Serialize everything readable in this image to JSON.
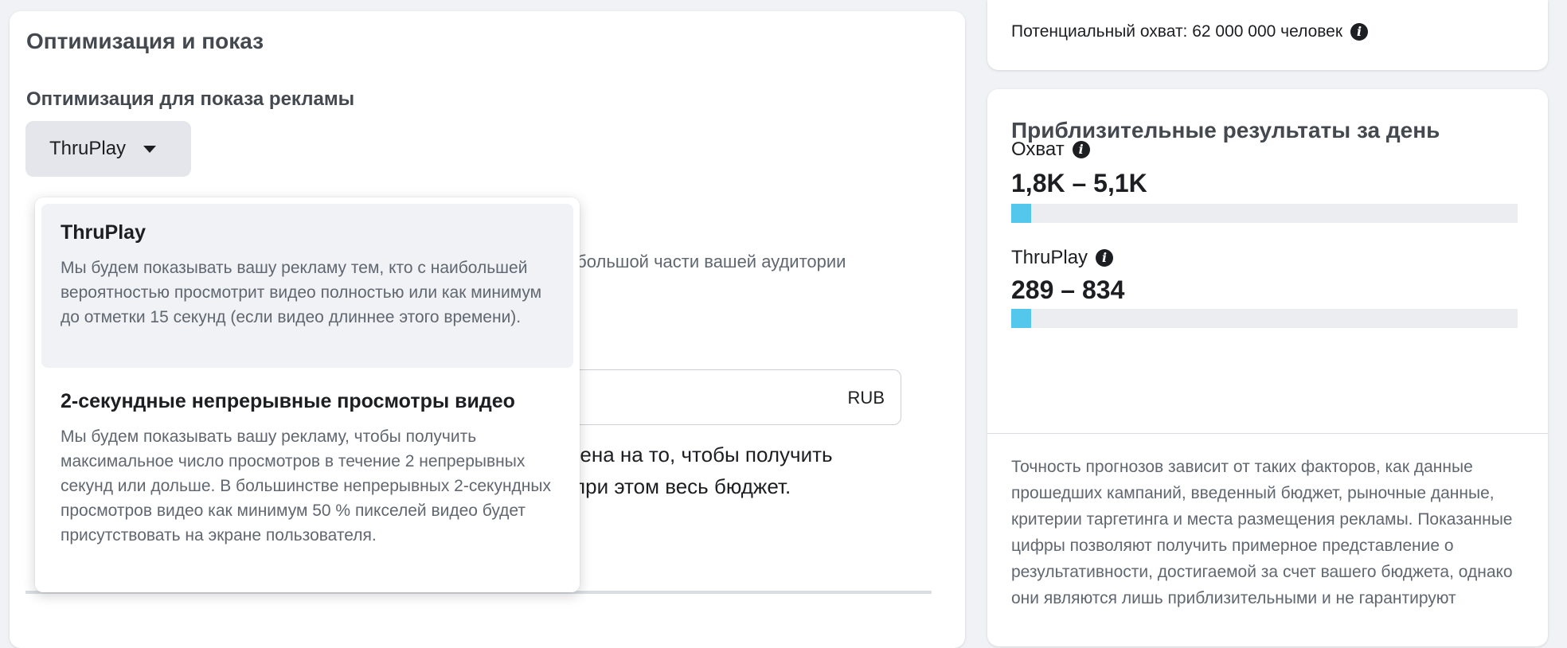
{
  "optimization": {
    "section_title": "Оптимизация и показ",
    "label": "Оптимизация для показа рекламы",
    "selected": "ThruPlay",
    "options": [
      {
        "title": "ThruPlay",
        "description": "Мы будем показывать вашу рекламу тем, кто с наибольшей вероятностью просмотрит видео полностью или как минимум до отметки 15 секунд (если видео длиннее этого времени)."
      },
      {
        "title": "2-секундные непрерывные просмотры видео",
        "description": "Мы будем показывать вашу рекламу, чтобы получить максимальное число просмотров в течение 2 непрерывных секунд или дольше. В большинстве непрерывных 2-секундных просмотров видео как минимум 50 % пикселей видео будет присутствовать на экране пользователя."
      }
    ]
  },
  "background": {
    "hint_fragment": "небольшой части вашей аудитории",
    "budget_currency": "RUB",
    "line1": "влена на то, чтобы получить",
    "line2": "в при этом весь бюджет."
  },
  "reach": {
    "text": "Потенциальный охват: 62 000 000 человек"
  },
  "results": {
    "title": "Приблизительные результаты за день",
    "metrics": [
      {
        "label": "Охват",
        "value": "1,8K – 5,1K",
        "fill_fraction": 0.04
      },
      {
        "label": "ThruPlay",
        "value": "289 – 834",
        "fill_fraction": 0.04
      }
    ],
    "disclaimer": "Точность прогнозов зависит от таких факторов, как данные прошедших кампаний, введенный бюджет, рыночные данные, критерии таргетинга и места размещения рекламы. Показанные цифры позволяют получить примерное представление о результативности, достигаемой за счет вашего бюджета, однако они являются лишь приблизительными и не гарантируют"
  },
  "colors": {
    "bar_fill": "#54c7ec",
    "bar_track": "#ebedf0",
    "selected_option_bg": "#f0f2f5"
  },
  "icons": {
    "info": "info-icon",
    "dropdown": "caret-down-icon"
  }
}
